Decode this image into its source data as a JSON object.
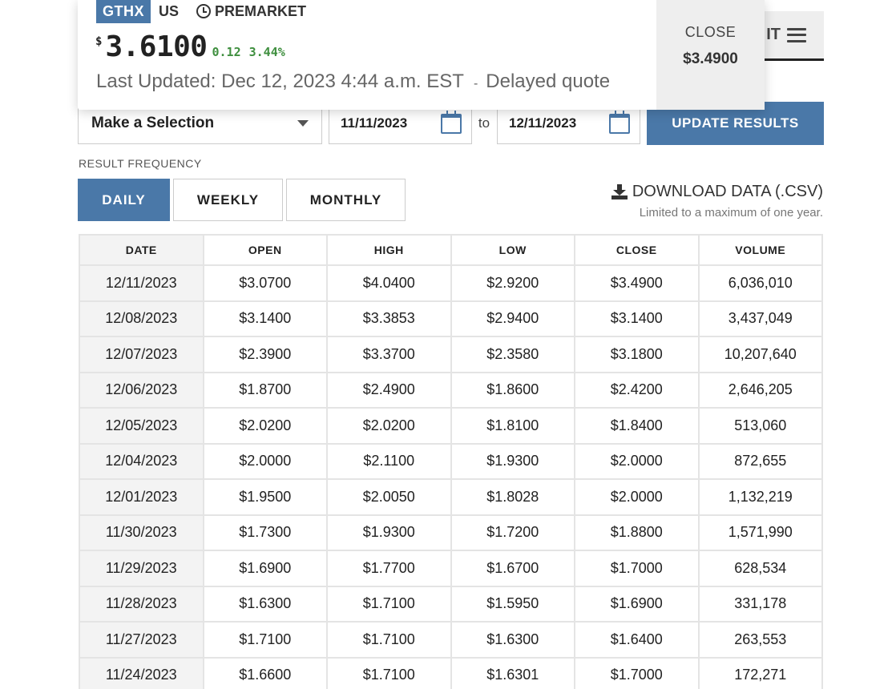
{
  "header": {
    "tab_fragment": "IT"
  },
  "quote": {
    "ticker": "GTHX",
    "exchange": "US",
    "session": "PREMARKET",
    "currency_symbol": "$",
    "price": "3.6100",
    "change": "0.12",
    "change_pct": "3.44%",
    "last_updated": "Last Updated: Dec 12, 2023 4:44 a.m. EST",
    "delayed_sep": "-",
    "delayed": "Delayed quote",
    "close_label": "CLOSE",
    "close_value": "$3.4900",
    "change_color": "#3f8f3f"
  },
  "filters": {
    "selection_label": "Make a Selection",
    "start_date": "11/11/2023",
    "to_label": "to",
    "end_date": "12/11/2023",
    "update_label": "UPDATE RESULTS",
    "accent_color": "#4a78a8"
  },
  "frequency": {
    "label": "RESULT FREQUENCY",
    "options": [
      "DAILY",
      "WEEKLY",
      "MONTHLY"
    ],
    "active": "DAILY"
  },
  "download": {
    "label": "DOWNLOAD DATA (.CSV)",
    "note": "Limited to a maximum of one year."
  },
  "table": {
    "columns": [
      "DATE",
      "OPEN",
      "HIGH",
      "LOW",
      "CLOSE",
      "VOLUME"
    ],
    "rows": [
      [
        "12/11/2023",
        "$3.0700",
        "$4.0400",
        "$2.9200",
        "$3.4900",
        "6,036,010"
      ],
      [
        "12/08/2023",
        "$3.1400",
        "$3.3853",
        "$2.9400",
        "$3.1400",
        "3,437,049"
      ],
      [
        "12/07/2023",
        "$2.3900",
        "$3.3700",
        "$2.3580",
        "$3.1800",
        "10,207,640"
      ],
      [
        "12/06/2023",
        "$1.8700",
        "$2.4900",
        "$1.8600",
        "$2.4200",
        "2,646,205"
      ],
      [
        "12/05/2023",
        "$2.0200",
        "$2.0200",
        "$1.8100",
        "$1.8400",
        "513,060"
      ],
      [
        "12/04/2023",
        "$2.0000",
        "$2.1100",
        "$1.9300",
        "$2.0000",
        "872,655"
      ],
      [
        "12/01/2023",
        "$1.9500",
        "$2.0050",
        "$1.8028",
        "$2.0000",
        "1,132,219"
      ],
      [
        "11/30/2023",
        "$1.7300",
        "$1.9300",
        "$1.7200",
        "$1.8800",
        "1,571,990"
      ],
      [
        "11/29/2023",
        "$1.6900",
        "$1.7700",
        "$1.6700",
        "$1.7000",
        "628,534"
      ],
      [
        "11/28/2023",
        "$1.6300",
        "$1.7100",
        "$1.5950",
        "$1.6900",
        "331,178"
      ],
      [
        "11/27/2023",
        "$1.7100",
        "$1.7100",
        "$1.6300",
        "$1.6400",
        "263,553"
      ],
      [
        "11/24/2023",
        "$1.6600",
        "$1.7100",
        "$1.6301",
        "$1.7000",
        "172,271"
      ]
    ]
  }
}
